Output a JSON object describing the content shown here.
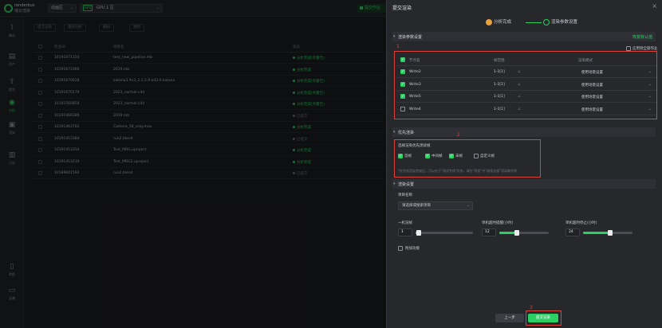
{
  "app": {
    "logo_line1": "renderbus",
    "logo_line2": "瑞云渲染"
  },
  "topbar": {
    "region": "动画区",
    "gpu_tag": "GPU",
    "gpu_label": "GPU 1 区",
    "submit_label": "提交作业"
  },
  "sidebar": {
    "items": [
      {
        "label": "概况",
        "icon": "activity-icon"
      },
      {
        "label": "资产",
        "icon": "assets-icon"
      },
      {
        "label": "提交",
        "icon": "upload-icon"
      },
      {
        "label": "分析",
        "icon": "analysis-icon"
      },
      {
        "label": "渲染",
        "icon": "render-icon"
      },
      {
        "label": "日志",
        "icon": "chart-icon"
      },
      {
        "label": "帮助",
        "icon": "document-icon"
      },
      {
        "label": "云端",
        "icon": "monitor-icon"
      }
    ]
  },
  "toolbar": {
    "buttons": [
      "提交渲染",
      "重新分析",
      "删除",
      "更新"
    ]
  },
  "table": {
    "headers": [
      "作业ID",
      "场景名",
      "状态"
    ],
    "rows": [
      {
        "id": "10191671150",
        "name": "test_new_pipeline.mb",
        "status": "分析完成(有警告)",
        "kind": "warn"
      },
      {
        "id": "10191671066",
        "name": "2019.mb",
        "status": "分析完成",
        "kind": "ok"
      },
      {
        "id": "10191670628",
        "name": "katana3.9v3_2.1.2.9-kd3.0.katana",
        "status": "分析完成(有警告)",
        "kind": "warn"
      },
      {
        "id": "10191670179",
        "name": "2023_normal.c4d",
        "status": "分析完成(有警告)",
        "kind": "warn"
      },
      {
        "id": "10191560858",
        "name": "2023_normal.c4d",
        "status": "分析完成(有警告)",
        "kind": "warn"
      },
      {
        "id": "10191466386",
        "name": "2019.mb",
        "status": "已提交",
        "kind": "grey"
      },
      {
        "id": "10191463702",
        "name": "Camera_58_vray.max",
        "status": "分析完成",
        "kind": "ok"
      },
      {
        "id": "10191453384",
        "name": "run2.blend",
        "status": "已提交",
        "kind": "grey"
      },
      {
        "id": "10191453354",
        "name": "Test_MRG.uproject",
        "status": "分析完成",
        "kind": "ok"
      },
      {
        "id": "10191453219",
        "name": "Test_MRG2.uproject",
        "status": "分析完成",
        "kind": "ok"
      },
      {
        "id": "10189641592",
        "name": "run2.blend",
        "status": "已提交",
        "kind": "grey"
      }
    ]
  },
  "drawer": {
    "title": "提交渲染",
    "close": "×",
    "steps": [
      "分析完成",
      "渲染参数设置"
    ],
    "section1": {
      "title": "渲染参数设置",
      "link": "恢复默认值"
    },
    "sync_label": "应用到全部作业",
    "write_headers": [
      "节点名",
      "帧范围",
      "渲染模式"
    ],
    "writes": [
      {
        "name": "Write2",
        "range": "1-1[1]",
        "mode": "使用场景设置",
        "checked": true
      },
      {
        "name": "Write3",
        "range": "1-1[1]",
        "mode": "使用场景设置",
        "checked": true
      },
      {
        "name": "Write5",
        "range": "1-1[1]",
        "mode": "使用场景设置",
        "checked": true
      },
      {
        "name": "Write4",
        "range": "1-1[1]",
        "mode": "使用场景设置",
        "checked": false
      }
    ],
    "section2": {
      "title": "优先渲染"
    },
    "priority_label": "选择渲染优先测试帧",
    "priority_options": [
      {
        "label": "首帧",
        "checked": true
      },
      {
        "label": "中间帧",
        "checked": true
      },
      {
        "label": "末帧",
        "checked": true
      },
      {
        "label": "自定义帧",
        "checked": false
      }
    ],
    "priority_hint": "*优先帧渲染完成后，可以在于\"测试完成\"状态，请在\"预览\"中\"继续全部\"渲染剩余帧",
    "section3": {
      "title": "渲染设置"
    },
    "project_label": "项目名称",
    "project_value": "请选择或搜索项目",
    "frames_label": "一机渲帧",
    "frames_value": "1",
    "frames_level": 0.05,
    "timeout_warn_label": "单机超时提醒(小时)",
    "timeout_warn_value": "12",
    "timeout_warn_level": 0.35,
    "timeout_stop_label": "单机超时停止(小时)",
    "timeout_stop_value": "24",
    "timeout_stop_level": 0.55,
    "extra_label": "附加功能",
    "btn_prev": "上一步",
    "btn_submit": "提交渲染"
  },
  "annotations": [
    "1",
    "2",
    "3"
  ]
}
